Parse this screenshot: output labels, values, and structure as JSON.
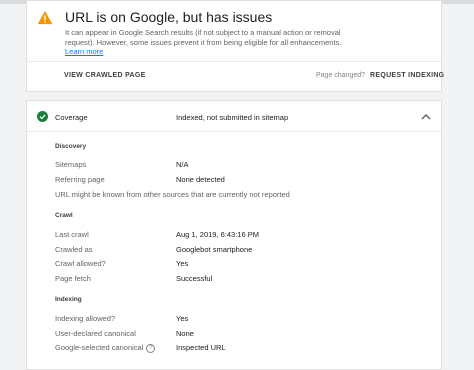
{
  "issue_card": {
    "title": "URL is on Google, but has issues",
    "description": "It can appear in Google Search results (if not subject to a manual action or removal request). However, some issues prevent it from being eligible for all enhancements.",
    "learn_more": "Learn more",
    "view_crawled_label": "VIEW CRAWLED PAGE",
    "page_changed_label": "Page changed?",
    "request_indexing_label": "REQUEST INDEXING",
    "warning_color": "#f29900"
  },
  "coverage": {
    "label": "Coverage",
    "status": "Indexed, not submitted in sitemap",
    "status_color": "#188038",
    "sections": {
      "discovery": {
        "heading": "Discovery",
        "sitemaps": {
          "label": "Sitemaps",
          "value": "N/A"
        },
        "referring_page": {
          "label": "Referring page",
          "value": "None detected"
        },
        "note": "URL might be known from other sources that are currently not reported"
      },
      "crawl": {
        "heading": "Crawl",
        "last_crawl": {
          "label": "Last crawl",
          "value": "Aug 1, 2019, 6:43:16 PM"
        },
        "crawled_as": {
          "label": "Crawled as",
          "value": "Googlebot smartphone"
        },
        "crawl_allowed": {
          "label": "Crawl allowed?",
          "value": "Yes"
        },
        "page_fetch": {
          "label": "Page fetch",
          "value": "Successful"
        }
      },
      "indexing": {
        "heading": "Indexing",
        "indexing_allowed": {
          "label": "Indexing allowed?",
          "value": "Yes"
        },
        "user_canonical": {
          "label": "User-declared canonical",
          "value": "None"
        },
        "google_canonical": {
          "label": "Google-selected canonical",
          "value": "Inspected URL"
        }
      }
    }
  }
}
